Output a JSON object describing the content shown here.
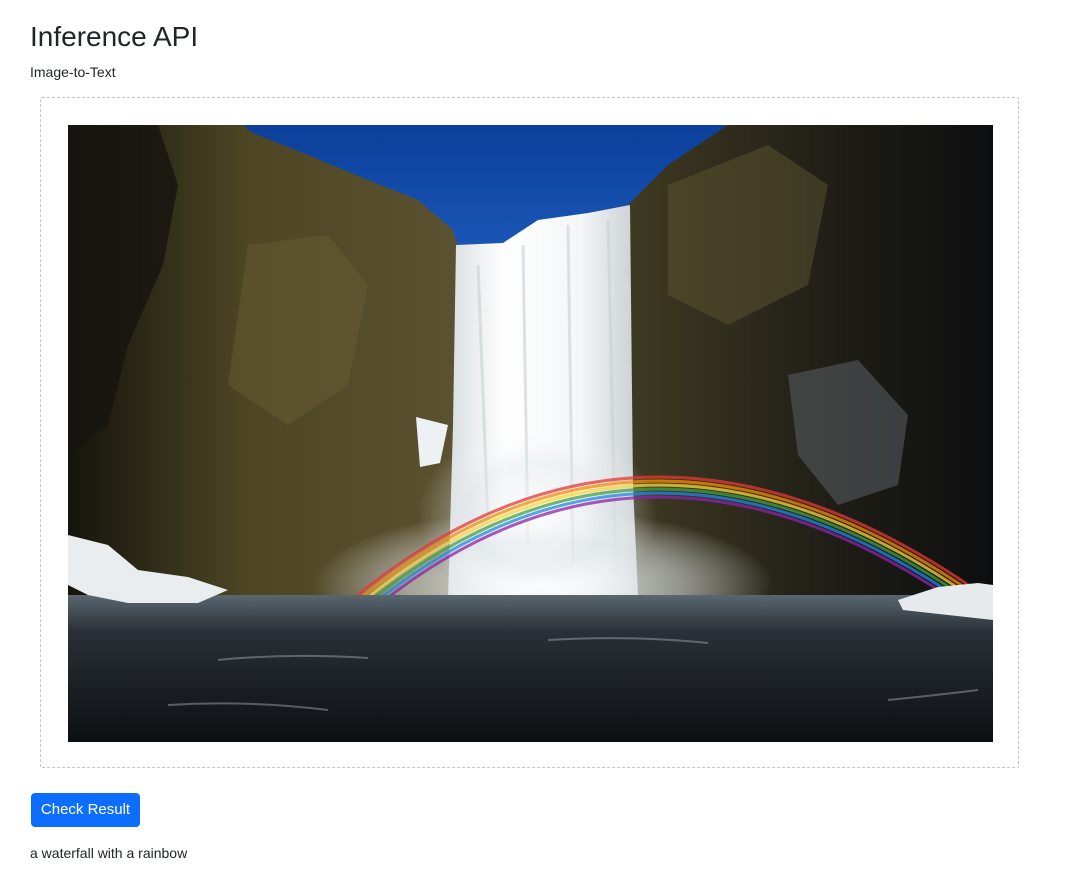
{
  "page": {
    "title": "Inference API",
    "subtitle": "Image-to-Text"
  },
  "upload": {
    "image_subject": "waterfall with a rainbow"
  },
  "actions": {
    "check_label": "Check Result",
    "accent_color": "#0d6efd"
  },
  "result": {
    "text": "a waterfall with a rainbow"
  }
}
